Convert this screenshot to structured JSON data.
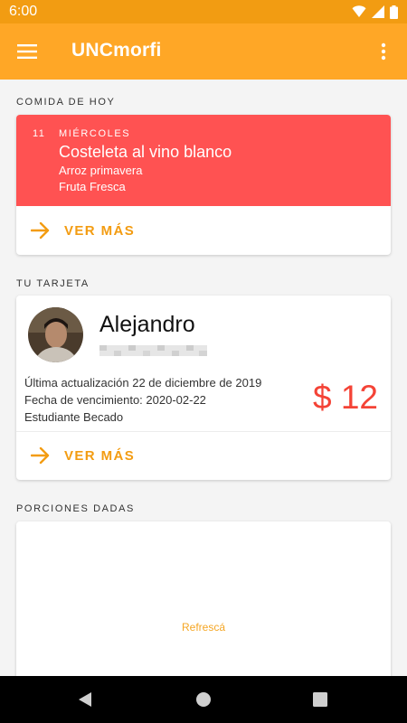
{
  "status_bar": {
    "time": "6:00",
    "icons": [
      "wifi-icon",
      "signal-icon",
      "battery-icon"
    ],
    "color": "#f29c12"
  },
  "app_bar": {
    "title": "UNCmorfi",
    "color": "#ffa726",
    "icons": [
      "menu-icon",
      "overflow-menu-icon"
    ]
  },
  "today_section": {
    "label": "COMIDA DE HOY",
    "meal": {
      "day": "11",
      "weekday": "MIÉRCOLES",
      "main": "Costeleta al vino blanco",
      "side1": "Arroz primavera",
      "side2": "Fruta Fresca",
      "color": "#ff5252"
    },
    "more_label": "VER MÁS"
  },
  "card_section": {
    "label": "TU TARJETA",
    "name": "Alejandro",
    "updated": "Última actualización 22 de diciembre de 2019",
    "expiration": "Fecha de vencimiento: 2020-02-22",
    "type": "Estudiante Becado",
    "balance": "$ 12",
    "balance_color": "#f44336",
    "more_label": "VER MÁS"
  },
  "portions_section": {
    "label": "PORCIONES DADAS",
    "refresh_label": "Refrescá"
  },
  "accent_color": "#f39c12",
  "nav_bar": {
    "icons": [
      "back-icon",
      "home-icon",
      "recents-icon"
    ]
  }
}
